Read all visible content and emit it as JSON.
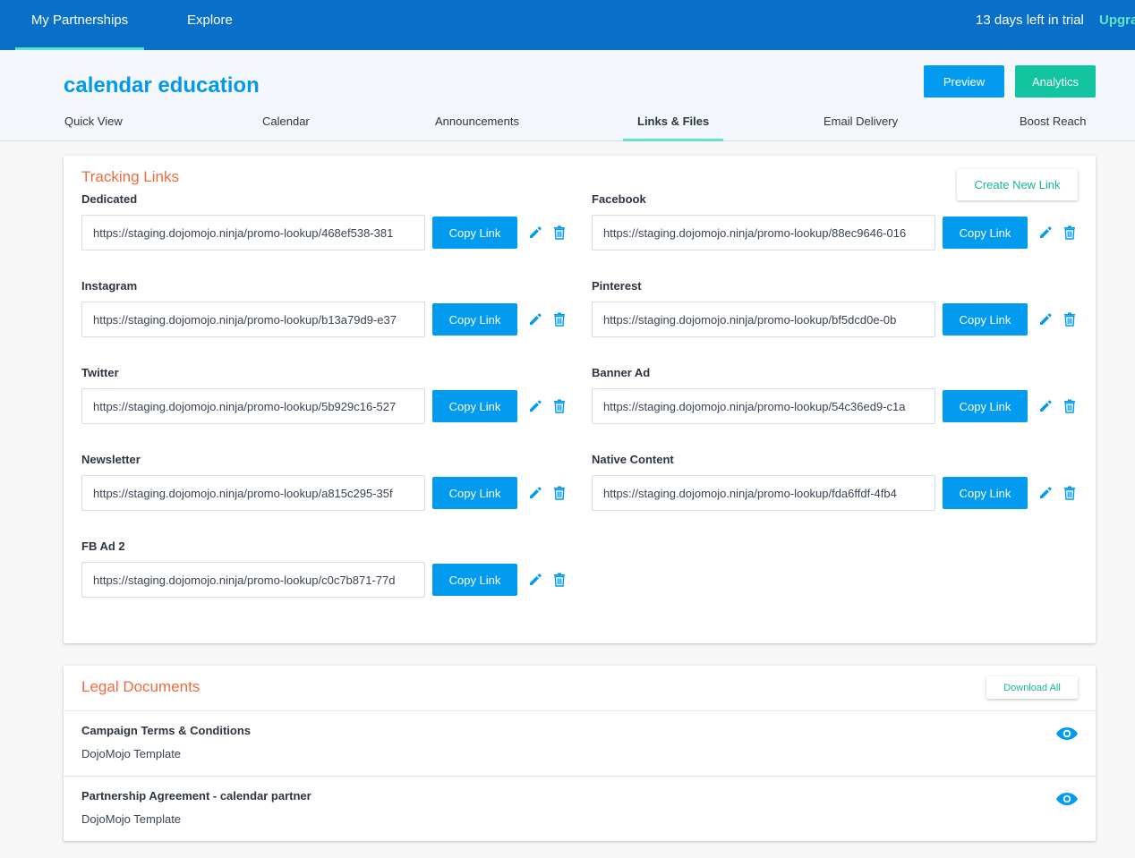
{
  "nav": {
    "tabs": [
      {
        "label": "My Partnerships",
        "active": true
      },
      {
        "label": "Explore",
        "active": false
      }
    ],
    "trial_text": "13 days left in trial",
    "upgrade_label": "Upgra"
  },
  "header": {
    "title": "calendar education",
    "preview_label": "Preview",
    "analytics_label": "Analytics",
    "tabs": [
      "Quick View",
      "Calendar",
      "Announcements",
      "Links & Files",
      "Email Delivery",
      "Boost Reach"
    ],
    "active_tab": "Links & Files"
  },
  "tracking": {
    "title": "Tracking Links",
    "create_label": "Create New Link",
    "copy_label": "Copy Link",
    "links": [
      {
        "label": "Dedicated",
        "url": "https://staging.dojomojo.ninja/promo-lookup/468ef538-381"
      },
      {
        "label": "Facebook",
        "url": "https://staging.dojomojo.ninja/promo-lookup/88ec9646-016"
      },
      {
        "label": "Instagram",
        "url": "https://staging.dojomojo.ninja/promo-lookup/b13a79d9-e37"
      },
      {
        "label": "Pinterest",
        "url": "https://staging.dojomojo.ninja/promo-lookup/bf5dcd0e-0b"
      },
      {
        "label": "Twitter",
        "url": "https://staging.dojomojo.ninja/promo-lookup/5b929c16-527"
      },
      {
        "label": "Banner Ad",
        "url": "https://staging.dojomojo.ninja/promo-lookup/54c36ed9-c1a"
      },
      {
        "label": "Newsletter",
        "url": "https://staging.dojomojo.ninja/promo-lookup/a815c295-35f"
      },
      {
        "label": "Native Content",
        "url": "https://staging.dojomojo.ninja/promo-lookup/fda6ffdf-4fb4"
      },
      {
        "label": "FB Ad 2",
        "url": "https://staging.dojomojo.ninja/promo-lookup/c0c7b871-77d"
      }
    ]
  },
  "legal": {
    "title": "Legal Documents",
    "download_label": "Download All",
    "docs": [
      {
        "title": "Campaign Terms & Conditions",
        "subtitle": "DojoMojo Template"
      },
      {
        "title": "Partnership Agreement - calendar partner",
        "subtitle": "DojoMojo Template"
      }
    ]
  },
  "colors": {
    "nav_bg": "#0a6fc8",
    "accent_blue": "#039bf0",
    "accent_green": "#12c5a0",
    "section_title": "#f06b3c",
    "tab_underline": "#5ee6c4"
  },
  "icons": {
    "edit": "pencil-icon",
    "delete": "trash-icon",
    "view": "eye-icon"
  }
}
